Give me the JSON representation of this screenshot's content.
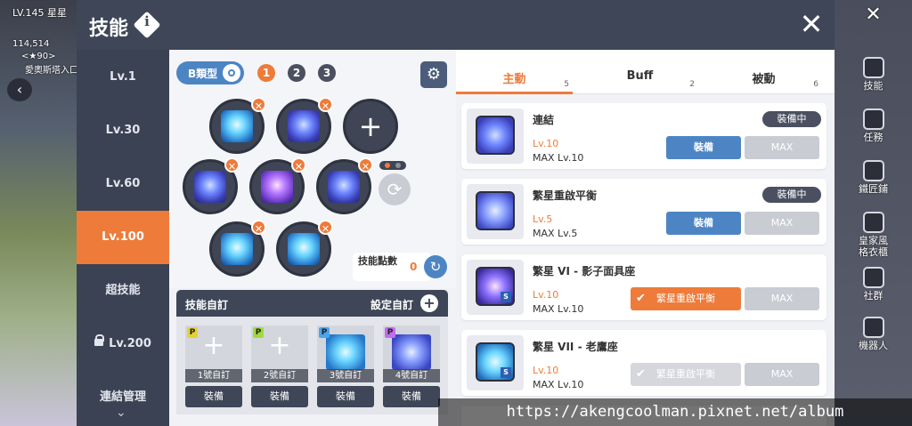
{
  "hud": {
    "level": "LV.145",
    "player_name": "星星",
    "coords": "114,514",
    "location_line": "<★90>",
    "map_name": "愛奧斯塔入口"
  },
  "modal": {
    "title": "技能",
    "close_icon": "close-icon",
    "info_icon": "info-icon"
  },
  "level_sidebar": {
    "items": [
      {
        "label": "Lv.1"
      },
      {
        "label": "Lv.30"
      },
      {
        "label": "Lv.60"
      },
      {
        "label": "Lv.100",
        "active": true
      },
      {
        "label": "超技能"
      },
      {
        "label": "Lv.200",
        "locked": true
      },
      {
        "label": "連結管理"
      }
    ]
  },
  "tree": {
    "type_toggle_label": "B類型",
    "presets": [
      "1",
      "2",
      "3"
    ],
    "active_preset": "1",
    "settings_icon": "gear-icon",
    "skill_points_label": "技能點數",
    "skill_points_value": "0",
    "add_symbol": "+",
    "remove_symbol": "✕"
  },
  "custom": {
    "title": "技能自訂",
    "set_label": "設定自訂",
    "cards": [
      {
        "tag": "P",
        "tag_color": "#e6d22e",
        "label": "1號自訂",
        "empty": true,
        "equip": "裝備"
      },
      {
        "tag": "P",
        "tag_color": "#9fdc3a",
        "label": "2號自訂",
        "empty": true,
        "equip": "裝備"
      },
      {
        "tag": "P",
        "tag_color": "#4da3f0",
        "label": "3號自訂",
        "empty": false,
        "equip": "裝備"
      },
      {
        "tag": "P",
        "tag_color": "#c16cf0",
        "label": "4號自訂",
        "empty": false,
        "equip": "裝備"
      }
    ]
  },
  "tabs": [
    {
      "label": "主動",
      "count": "5",
      "active": true
    },
    {
      "label": "Buff",
      "count": "2"
    },
    {
      "label": "被動",
      "count": "6"
    }
  ],
  "skills": [
    {
      "name": "連結",
      "lv": "Lv.10",
      "max": "MAX Lv.10",
      "badge": "裝備中",
      "equip": "裝備",
      "max_btn": "MAX"
    },
    {
      "name": "繁星重啟平衡",
      "lv": "Lv.5",
      "max": "MAX Lv.5",
      "badge": "裝備中",
      "equip": "裝備",
      "max_btn": "MAX"
    },
    {
      "name": "繁星 VI - 影子面具座",
      "lv": "Lv.10",
      "max": "MAX Lv.10",
      "link": "繁星重啟平衡",
      "max_btn": "MAX"
    },
    {
      "name": "繁星 VII - 老鷹座",
      "lv": "Lv.10",
      "max": "MAX Lv.10",
      "link": "繁星重啟平衡",
      "max_btn": "MAX"
    }
  ],
  "right_nav": [
    {
      "label": "技能",
      "icon": "skill-icon"
    },
    {
      "label": "任務",
      "icon": "quest-icon"
    },
    {
      "label": "鐵匠鋪",
      "icon": "anvil-icon"
    },
    {
      "label": "皇家風格衣櫃",
      "icon": "wardrobe-icon"
    },
    {
      "label": "社群",
      "icon": "community-icon"
    },
    {
      "label": "機器人",
      "icon": "robot-icon"
    }
  ],
  "watermark": "https://akengcoolman.pixnet.net/album",
  "colors": {
    "accent": "#ee7b3a",
    "header": "#3e4657",
    "sidebar": "#3b4253",
    "equip_blue": "#4d85c4"
  }
}
